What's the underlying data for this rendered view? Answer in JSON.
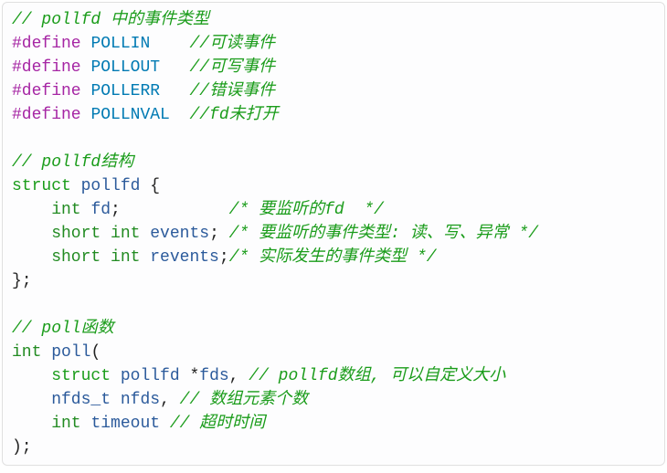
{
  "code": {
    "c1": "// pollfd 中的事件类型",
    "d1a": "#define",
    "d1b": "POLLIN",
    "d1c": "//可读事件",
    "d2a": "#define",
    "d2b": "POLLOUT",
    "d2c": "//可写事件",
    "d3a": "#define",
    "d3b": "POLLERR",
    "d3c": "//错误事件",
    "d4a": "#define",
    "d4b": "POLLNVAL",
    "d4c": "//fd未打开",
    "c2": "// pollfd结构",
    "s1a": "struct",
    "s1b": "pollfd",
    "s1c": " {",
    "f1a": "    int",
    "f1b": "fd",
    "f1c": ";           ",
    "f1d": "/* 要监听的fd  */",
    "f2a": "    short int",
    "f2b": "events",
    "f2c": "; ",
    "f2d": "/* 要监听的事件类型: 读、写、异常 */",
    "f3a": "    short int",
    "f3b": "revents",
    "f3c": ";",
    "f3d": "/* 实际发生的事件类型 */",
    "s2": "};",
    "c3": "// poll函数",
    "p1a": "int",
    "p1b": "poll",
    "p1c": "(",
    "p2a": "    struct",
    "p2b": "pollfd",
    "p2c": " *",
    "p2d": "fds",
    "p2e": ", ",
    "p2f": "// pollfd数组, 可以自定义大小",
    "p3a": "    nfds_t",
    "p3b": "nfds",
    "p3c": ", ",
    "p3d": "// 数组元素个数",
    "p4a": "    int",
    "p4b": "timeout",
    "p4c": "// 超时时间",
    "p5": ");"
  }
}
